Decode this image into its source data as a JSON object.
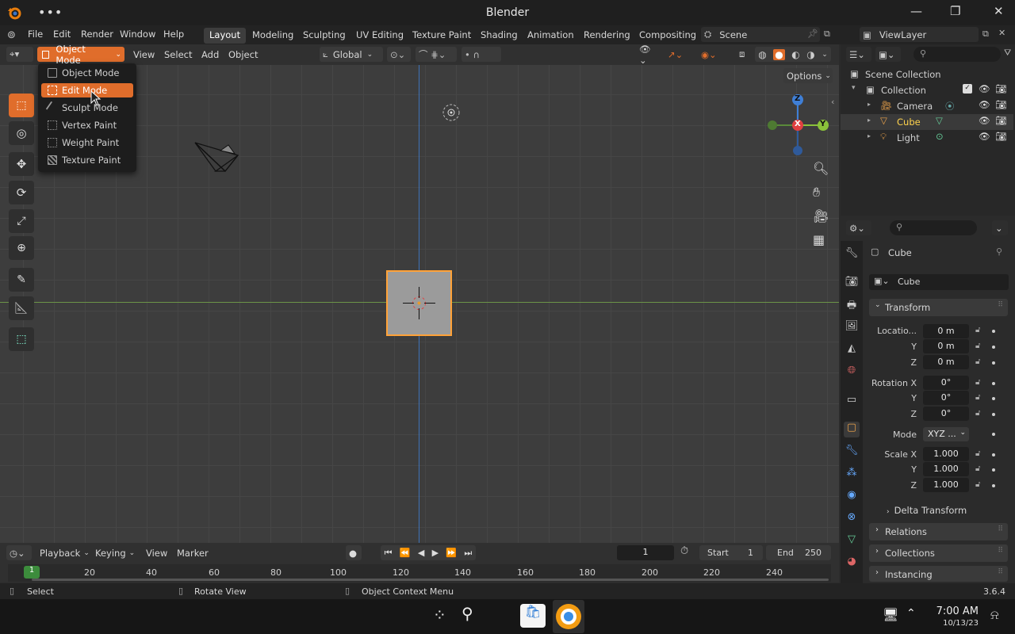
{
  "app": {
    "title": "Blender",
    "version": "3.6.4"
  },
  "colors": {
    "accent": "#e06d2b",
    "selected_text": "#ffd34d",
    "x_axis": "#e04040",
    "y_axis": "#8ac23a",
    "z_axis": "#3f7fd6"
  },
  "menu": [
    "File",
    "Edit",
    "Render",
    "Window",
    "Help"
  ],
  "workspaces": [
    "Layout",
    "Modeling",
    "Sculpting",
    "UV Editing",
    "Texture Paint",
    "Shading",
    "Animation",
    "Rendering",
    "Compositing"
  ],
  "active_workspace": "Layout",
  "scene": "Scene",
  "view_layer": "ViewLayer",
  "viewport_header": {
    "mode": "Object Mode",
    "menus": [
      "View",
      "Select",
      "Add",
      "Object"
    ],
    "transform_orientation": "Global",
    "options": "Options"
  },
  "mode_dropdown": {
    "items": [
      "Object Mode",
      "Edit Mode",
      "Sculpt Mode",
      "Vertex Paint",
      "Weight Paint",
      "Texture Paint"
    ],
    "highlighted": "Edit Mode"
  },
  "gizmo": {
    "x": "X",
    "y": "Y",
    "z": "Z"
  },
  "outliner": {
    "root": "Scene Collection",
    "collection": "Collection",
    "items": [
      "Camera",
      "Cube",
      "Light"
    ],
    "selected": "Cube",
    "search_placeholder": ""
  },
  "properties": {
    "object_name": "Cube",
    "data_name": "Cube",
    "transform_label": "Transform",
    "location_label": "Locatio...",
    "rotation_label": "Rotation X",
    "mode_label": "Mode",
    "scale_label": "Scale X",
    "y_label": "Y",
    "z_label": "Z",
    "location": [
      "0 m",
      "0 m",
      "0 m"
    ],
    "rotation": [
      "0°",
      "0°",
      "0°"
    ],
    "rotation_mode": "XYZ ...",
    "scale": [
      "1.000",
      "1.000",
      "1.000"
    ],
    "delta": "Delta Transform",
    "panels": [
      "Relations",
      "Collections",
      "Instancing"
    ]
  },
  "timeline": {
    "menus": [
      "Playback",
      "Keying",
      "View",
      "Marker"
    ],
    "current_frame": "1",
    "start_label": "Start",
    "start": "1",
    "end_label": "End",
    "end": "250",
    "ticks": [
      "1",
      "20",
      "40",
      "60",
      "80",
      "100",
      "120",
      "140",
      "160",
      "180",
      "200",
      "220",
      "240"
    ]
  },
  "statusbar": {
    "select": "Select",
    "rotate": "Rotate View",
    "context": "Object Context Menu"
  },
  "taskbar": {
    "time": "7:00 AM",
    "date": "10/13/23"
  }
}
